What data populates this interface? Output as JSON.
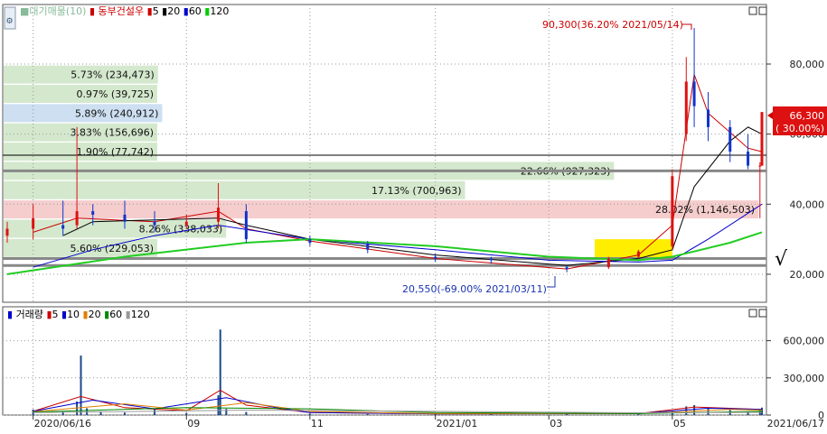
{
  "price_panel": {
    "legend": {
      "source": "■대기매물(10)",
      "stock_name": "동부건설우",
      "ma_label": "",
      "ma_items": [
        {
          "label": "5",
          "color": "#cc0000"
        },
        {
          "label": "20",
          "color": "#000000"
        },
        {
          "label": "60",
          "color": "#0000cc"
        },
        {
          "label": "120",
          "color": "#00cc00"
        }
      ]
    },
    "last_price": "66,300",
    "last_change": "( 30.00%)",
    "check_mark": "√",
    "max_annotation": "90,300(36.20% 2021/05/14)",
    "min_annotation": "20,550(-69.00% 2021/03/11)"
  },
  "volume_panel": {
    "legend": {
      "title": "거래량",
      "ma_items": [
        {
          "label": "5",
          "color": "#cc0000"
        },
        {
          "label": "10",
          "color": "#0000cc"
        },
        {
          "label": "20",
          "color": "#e08000"
        },
        {
          "label": "60",
          "color": "#008800"
        },
        {
          "label": "120",
          "color": "#999999"
        }
      ]
    }
  },
  "chart_data": [
    {
      "type": "candlestick",
      "stock": "동부건설우",
      "y_ticks": [
        "80,000",
        "60,000",
        "40,000",
        "20,000"
      ],
      "y_tick_values": [
        80000,
        60000,
        40000,
        20000
      ],
      "ylim": [
        12000,
        97000
      ],
      "x_ticks": [
        "2020/06/16",
        "09",
        "11",
        "2021/01",
        "03",
        "05",
        "2021/06/17"
      ],
      "x_tick_dates": [
        "2020-06-16",
        "2020-09-01",
        "2020-11-02",
        "2021-01-04",
        "2021-03-02",
        "2021-05-03",
        "2021-06-17"
      ],
      "date_range": [
        "2020-06-03",
        "2021-06-17"
      ],
      "overlay_color": "#ffee00",
      "resistance_lines": [
        54000,
        49500,
        24500,
        22500
      ],
      "volume_profile": [
        {
          "label": "5.73% (234,473)",
          "price": 77000,
          "color": "#cfe5c8"
        },
        {
          "label": "0.97% (39,725)",
          "price": 71500,
          "color": "#cfe5c8"
        },
        {
          "label": "5.89% (240,912)",
          "price": 66000,
          "color": "#c8dcf0"
        },
        {
          "label": "3.83% (156,696)",
          "price": 60500,
          "color": "#cfe5c8"
        },
        {
          "label": "1.90% (77,742)",
          "price": 55000,
          "color": "#cfe5c8"
        },
        {
          "label": "22.66% (927,323)",
          "price": 49500,
          "color": "#cfe5c8"
        },
        {
          "label": "17.13% (700,963)",
          "price": 44000,
          "color": "#cfe5c8"
        },
        {
          "label": "28.02% (1,146,503)",
          "price": 38500,
          "color": "#f4c8c8"
        },
        {
          "label": "8.26% (338,033)",
          "price": 33000,
          "color": "#cfe5c8"
        },
        {
          "label": "5.60% (229,053)",
          "price": 27500,
          "color": "#cfe5c8"
        }
      ],
      "candles": [
        {
          "d": "2020-06-03",
          "o": 31000,
          "h": 35000,
          "l": 29000,
          "c": 33000
        },
        {
          "d": "2020-06-16",
          "o": 33000,
          "h": 40000,
          "l": 30000,
          "c": 36000
        },
        {
          "d": "2020-07-01",
          "o": 34000,
          "h": 41000,
          "l": 31000,
          "c": 33000
        },
        {
          "d": "2020-07-08",
          "o": 34000,
          "h": 62000,
          "l": 33000,
          "c": 38000
        },
        {
          "d": "2020-07-16",
          "o": 38000,
          "h": 40000,
          "l": 34000,
          "c": 37000
        },
        {
          "d": "2020-08-01",
          "o": 37000,
          "h": 41000,
          "l": 33000,
          "c": 35000
        },
        {
          "d": "2020-08-16",
          "o": 35000,
          "h": 38000,
          "l": 32000,
          "c": 34000
        },
        {
          "d": "2020-09-01",
          "o": 34000,
          "h": 37000,
          "l": 33000,
          "c": 35000
        },
        {
          "d": "2020-09-17",
          "o": 35000,
          "h": 46000,
          "l": 33000,
          "c": 39000
        },
        {
          "d": "2020-10-01",
          "o": 38000,
          "h": 40000,
          "l": 29000,
          "c": 30000
        },
        {
          "d": "2020-11-02",
          "o": 30000,
          "h": 31000,
          "l": 28000,
          "c": 29000
        },
        {
          "d": "2020-12-01",
          "o": 28500,
          "h": 29500,
          "l": 26000,
          "c": 27000
        },
        {
          "d": "2021-01-04",
          "o": 25000,
          "h": 26000,
          "l": 23500,
          "c": 24500
        },
        {
          "d": "2021-02-01",
          "o": 24500,
          "h": 25000,
          "l": 23000,
          "c": 24000
        },
        {
          "d": "2021-03-11",
          "o": 22000,
          "h": 22500,
          "l": 20550,
          "c": 21500
        },
        {
          "d": "2021-04-01",
          "o": 22000,
          "h": 25000,
          "l": 21500,
          "c": 24500
        },
        {
          "d": "2021-04-16",
          "o": 25000,
          "h": 27000,
          "l": 24500,
          "c": 26500
        },
        {
          "d": "2021-05-03",
          "o": 28000,
          "h": 50000,
          "l": 27000,
          "c": 48000
        },
        {
          "d": "2021-05-10",
          "o": 60000,
          "h": 82000,
          "l": 58000,
          "c": 75000
        },
        {
          "d": "2021-05-14",
          "o": 75000,
          "h": 90300,
          "l": 62000,
          "c": 68000
        },
        {
          "d": "2021-05-21",
          "o": 67000,
          "h": 72000,
          "l": 58000,
          "c": 62000
        },
        {
          "d": "2021-06-01",
          "o": 62000,
          "h": 64000,
          "l": 52000,
          "c": 55000
        },
        {
          "d": "2021-06-10",
          "o": 55000,
          "h": 60000,
          "l": 50000,
          "c": 51000
        },
        {
          "d": "2021-06-16",
          "o": 51000,
          "h": 52000,
          "l": 36000,
          "c": 51000
        },
        {
          "d": "2021-06-17",
          "o": 51000,
          "h": 66300,
          "l": 51000,
          "c": 66300
        }
      ],
      "moving_averages": [
        {
          "name": "5",
          "color": "#cc0000",
          "points": [
            [
              "2020-06-16",
              32000
            ],
            [
              "2020-07-08",
              36000
            ],
            [
              "2020-08-16",
              35000
            ],
            [
              "2020-09-17",
              38000
            ],
            [
              "2020-10-01",
              33000
            ],
            [
              "2020-11-02",
              29500
            ],
            [
              "2021-01-04",
              24500
            ],
            [
              "2021-03-11",
              21500
            ],
            [
              "2021-04-16",
              25500
            ],
            [
              "2021-05-03",
              34000
            ],
            [
              "2021-05-14",
              77000
            ],
            [
              "2021-05-21",
              66000
            ],
            [
              "2021-06-10",
              56000
            ],
            [
              "2021-06-17",
              55000
            ]
          ]
        },
        {
          "name": "20",
          "color": "#000000",
          "points": [
            [
              "2020-07-01",
              31000
            ],
            [
              "2020-07-16",
              35000
            ],
            [
              "2020-08-16",
              35500
            ],
            [
              "2020-09-17",
              36000
            ],
            [
              "2020-10-01",
              34000
            ],
            [
              "2020-11-02",
              30000
            ],
            [
              "2021-01-04",
              25500
            ],
            [
              "2021-03-11",
              22500
            ],
            [
              "2021-04-16",
              24500
            ],
            [
              "2021-05-03",
              27000
            ],
            [
              "2021-05-14",
              45000
            ],
            [
              "2021-06-01",
              58000
            ],
            [
              "2021-06-10",
              62000
            ],
            [
              "2021-06-17",
              60000
            ]
          ]
        },
        {
          "name": "60",
          "color": "#0000cc",
          "points": [
            [
              "2020-06-16",
              22000
            ],
            [
              "2020-07-16",
              27000
            ],
            [
              "2020-08-16",
              31000
            ],
            [
              "2020-09-17",
              34000
            ],
            [
              "2020-11-02",
              30000
            ],
            [
              "2021-01-04",
              27000
            ],
            [
              "2021-03-02",
              24000
            ],
            [
              "2021-04-16",
              23500
            ],
            [
              "2021-05-03",
              24000
            ],
            [
              "2021-05-21",
              30000
            ],
            [
              "2021-06-17",
              40000
            ]
          ]
        },
        {
          "name": "120",
          "color": "#22cc22",
          "points": [
            [
              "2020-06-03",
              20000
            ],
            [
              "2020-08-01",
              25000
            ],
            [
              "2020-10-01",
              29000
            ],
            [
              "2020-11-02",
              30000
            ],
            [
              "2021-01-04",
              28000
            ],
            [
              "2021-03-02",
              25000
            ],
            [
              "2021-04-16",
              24000
            ],
            [
              "2021-05-03",
              25000
            ],
            [
              "2021-06-01",
              29000
            ],
            [
              "2021-06-17",
              32000
            ]
          ]
        }
      ]
    },
    {
      "type": "bar",
      "name": "거래량",
      "y_ticks": [
        "600,000",
        "300,000",
        "0"
      ],
      "y_tick_values": [
        600000,
        300000,
        0
      ],
      "ylim": [
        0,
        750000
      ],
      "date_range": [
        "2020-06-03",
        "2021-06-17"
      ],
      "bars": [
        [
          "2020-06-16",
          45000
        ],
        [
          "2020-07-01",
          28000
        ],
        [
          "2020-07-08",
          110000
        ],
        [
          "2020-07-10",
          480000
        ],
        [
          "2020-07-13",
          55000
        ],
        [
          "2020-07-20",
          30000
        ],
        [
          "2020-08-01",
          20000
        ],
        [
          "2020-08-16",
          45000
        ],
        [
          "2020-09-01",
          18000
        ],
        [
          "2020-09-17",
          160000
        ],
        [
          "2020-09-18",
          690000
        ],
        [
          "2020-09-21",
          50000
        ],
        [
          "2020-10-01",
          25000
        ],
        [
          "2020-11-02",
          12000
        ],
        [
          "2020-12-01",
          9000
        ],
        [
          "2021-01-04",
          8000
        ],
        [
          "2021-02-01",
          7000
        ],
        [
          "2021-03-11",
          9000
        ],
        [
          "2021-04-16",
          14000
        ],
        [
          "2021-05-03",
          30000
        ],
        [
          "2021-05-10",
          70000
        ],
        [
          "2021-05-14",
          80000
        ],
        [
          "2021-05-21",
          55000
        ],
        [
          "2021-06-01",
          40000
        ],
        [
          "2021-06-10",
          30000
        ],
        [
          "2021-06-16",
          45000
        ],
        [
          "2021-06-17",
          60000
        ]
      ],
      "moving_averages": [
        {
          "name": "5",
          "color": "#cc0000",
          "points": [
            [
              "2020-06-16",
              30000
            ],
            [
              "2020-07-10",
              150000
            ],
            [
              "2020-08-01",
              60000
            ],
            [
              "2020-09-01",
              35000
            ],
            [
              "2020-09-18",
              200000
            ],
            [
              "2020-10-01",
              80000
            ],
            [
              "2020-11-02",
              20000
            ],
            [
              "2021-01-04",
              10000
            ],
            [
              "2021-04-16",
              12000
            ],
            [
              "2021-05-14",
              65000
            ],
            [
              "2021-06-17",
              45000
            ]
          ]
        },
        {
          "name": "10",
          "color": "#0000cc",
          "points": [
            [
              "2020-06-16",
              30000
            ],
            [
              "2020-07-16",
              120000
            ],
            [
              "2020-08-16",
              50000
            ],
            [
              "2020-09-21",
              140000
            ],
            [
              "2020-10-16",
              60000
            ],
            [
              "2020-11-02",
              20000
            ],
            [
              "2021-01-04",
              10000
            ],
            [
              "2021-04-16",
              12000
            ],
            [
              "2021-05-21",
              55000
            ],
            [
              "2021-06-17",
              45000
            ]
          ]
        },
        {
          "name": "20",
          "color": "#e08000",
          "points": [
            [
              "2020-06-16",
              28000
            ],
            [
              "2020-08-01",
              90000
            ],
            [
              "2020-09-01",
              40000
            ],
            [
              "2020-10-01",
              100000
            ],
            [
              "2020-11-02",
              30000
            ],
            [
              "2021-01-04",
              12000
            ],
            [
              "2021-04-16",
              12000
            ],
            [
              "2021-06-01",
              45000
            ],
            [
              "2021-06-17",
              40000
            ]
          ]
        },
        {
          "name": "60",
          "color": "#008800",
          "points": [
            [
              "2020-06-16",
              25000
            ],
            [
              "2020-09-01",
              60000
            ],
            [
              "2020-11-02",
              50000
            ],
            [
              "2021-01-04",
              20000
            ],
            [
              "2021-04-16",
              12000
            ],
            [
              "2021-06-17",
              30000
            ]
          ]
        },
        {
          "name": "120",
          "color": "#999999",
          "points": [
            [
              "2020-06-16",
              20000
            ],
            [
              "2020-10-01",
              40000
            ],
            [
              "2021-01-04",
              30000
            ],
            [
              "2021-04-16",
              18000
            ],
            [
              "2021-06-17",
              22000
            ]
          ]
        }
      ]
    }
  ]
}
